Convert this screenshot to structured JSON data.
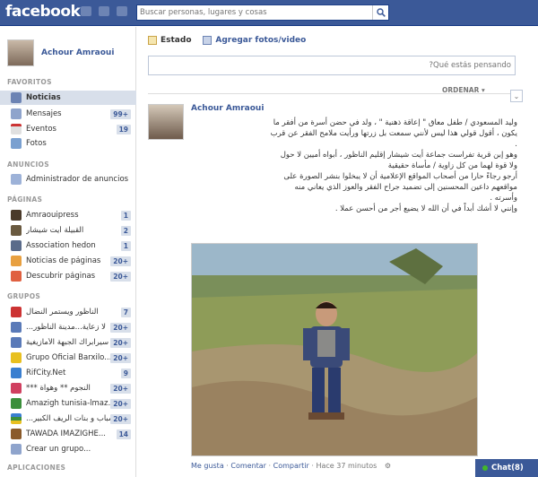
{
  "header": {
    "logo": "facebook",
    "search_placeholder": "Buscar personas, lugares y cosas"
  },
  "profile": {
    "name": "Achour Amraoui"
  },
  "sections": {
    "favoritos": "FAVORITOS",
    "anuncios": "ANUNCIOS",
    "paginas": "PÁGINAS",
    "grupos": "GRUPOS",
    "aplicaciones": "APLICACIONES"
  },
  "favorites": [
    {
      "label": "Noticias",
      "count": ""
    },
    {
      "label": "Mensajes",
      "count": "99+"
    },
    {
      "label": "Eventos",
      "count": "19"
    },
    {
      "label": "Fotos",
      "count": ""
    }
  ],
  "ads": [
    {
      "label": "Administrador de anuncios"
    }
  ],
  "pages": [
    {
      "label": "Amraouipress",
      "count": "1"
    },
    {
      "label": "القبيلة أيت شيشار",
      "count": "2"
    },
    {
      "label": "Association hedon",
      "count": "1"
    },
    {
      "label": "Noticias de páginas",
      "count": "20+"
    },
    {
      "label": "Descubrir páginas",
      "count": "20+"
    }
  ],
  "groups": [
    {
      "label": "الناظور ويستمر النضال",
      "count": "7"
    },
    {
      "label": "...لا زعاية...مدينة الناظور",
      "count": "20+"
    },
    {
      "label": "سيرابراك الجبهة الأمازيغية",
      "count": "20+"
    },
    {
      "label": "Grupo Oficial Barxilo...",
      "count": "20+"
    },
    {
      "label": "RifCity.Net",
      "count": "9"
    },
    {
      "label": "*** النجوم ** وهواة",
      "count": "20+"
    },
    {
      "label": "Amazigh tunisia-lmaz...",
      "count": "20+"
    },
    {
      "label": "...شباب و بنات الريف الكبير",
      "count": "20+"
    },
    {
      "label": "TAWADA IMAZIGHE...",
      "count": "14"
    },
    {
      "label": "Crear un grupo...",
      "count": ""
    }
  ],
  "composer": {
    "tab_status": "Estado",
    "tab_photo": "Agregar fotos/video",
    "placeholder": "?Qué estás pensando"
  },
  "feed": {
    "sort_label": "ORDENAR"
  },
  "post": {
    "author": "Achour Amraoui",
    "text": [
      "وليد المسعودي / طفل معاق \" إعاقة ذهنية \" ، ولد في حضن أسرة من أفقر ما",
      "يكون ، أقول قولي هذا ليس لأنني سمعت بل زرتها ورأيت ملامح الفقر عن قرب",
      ".",
      "وهو إبن قرية تفراست جماعة أيت شيشار إقليم الناظور ، أبواه أميين لا حول",
      "ولا قوة لهما من كل زاوية / مأساة حقيقية",
      "أرجو رجاءً حارا من أصحاب المواقع الإعلامية أن لا يبخلوا بنشر الصورة على",
      "مواقعهم داعين المحسنين إلى تضميد جراح الفقر والعوز الذي يعاني منه",
      "وأسرته .",
      "وإنني لا أشك أبداً في أن الله لا يضيع أجر من أحسن عملا ."
    ],
    "actions": {
      "like": "Me gusta",
      "comment": "Comentar",
      "share": "Compartir",
      "time": "Hace 37 minutos"
    }
  },
  "chat": {
    "label": "Chat(8)"
  },
  "colors": {
    "brand": "#3b5998",
    "nav_selected": "#d8dfea"
  }
}
